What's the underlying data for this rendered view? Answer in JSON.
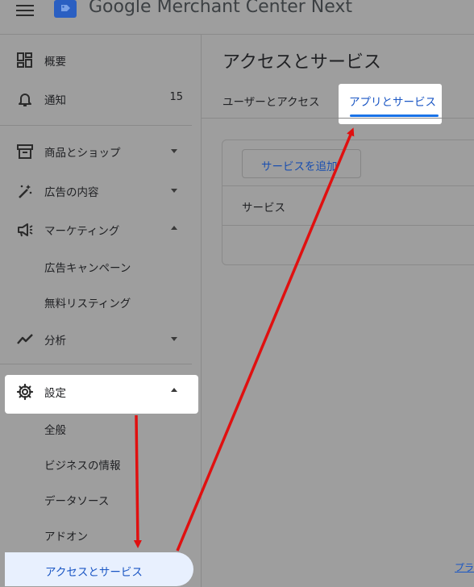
{
  "header": {
    "title": "Google Merchant Center Next",
    "menu_icon": "menu-icon",
    "logo_icon": "merchant-center-logo"
  },
  "sidebar": {
    "items": [
      {
        "label": "概要",
        "icon": "dashboard-icon"
      },
      {
        "label": "通知",
        "icon": "bell-icon",
        "count": "15"
      },
      {
        "label": "商品とショップ",
        "icon": "archive-box-icon"
      },
      {
        "label": "広告の内容",
        "icon": "magic-wand-icon"
      },
      {
        "label": "マーケティング",
        "icon": "megaphone-icon"
      },
      {
        "label": "分析",
        "icon": "trend-line-icon"
      },
      {
        "label": "設定",
        "icon": "gear-icon"
      }
    ],
    "marketing_sub": [
      "広告キャンペーン",
      "無料リスティング"
    ],
    "settings_sub": [
      "全般",
      "ビジネスの情報",
      "データソース",
      "アドオン",
      "アクセスとサービス"
    ]
  },
  "main": {
    "page_title": "アクセスとサービス",
    "tabs": [
      {
        "label": "ユーザーとアクセス",
        "selected": false
      },
      {
        "label": "アプリとサービス",
        "selected": true
      }
    ],
    "add_service_button": "サービスを追加",
    "table_header": "サービス",
    "footer_link": "プラ"
  },
  "colors": {
    "overlay_gray": "#9e9e9e",
    "accent_blue": "#1a73e8",
    "arrow_red": "#e01010"
  }
}
